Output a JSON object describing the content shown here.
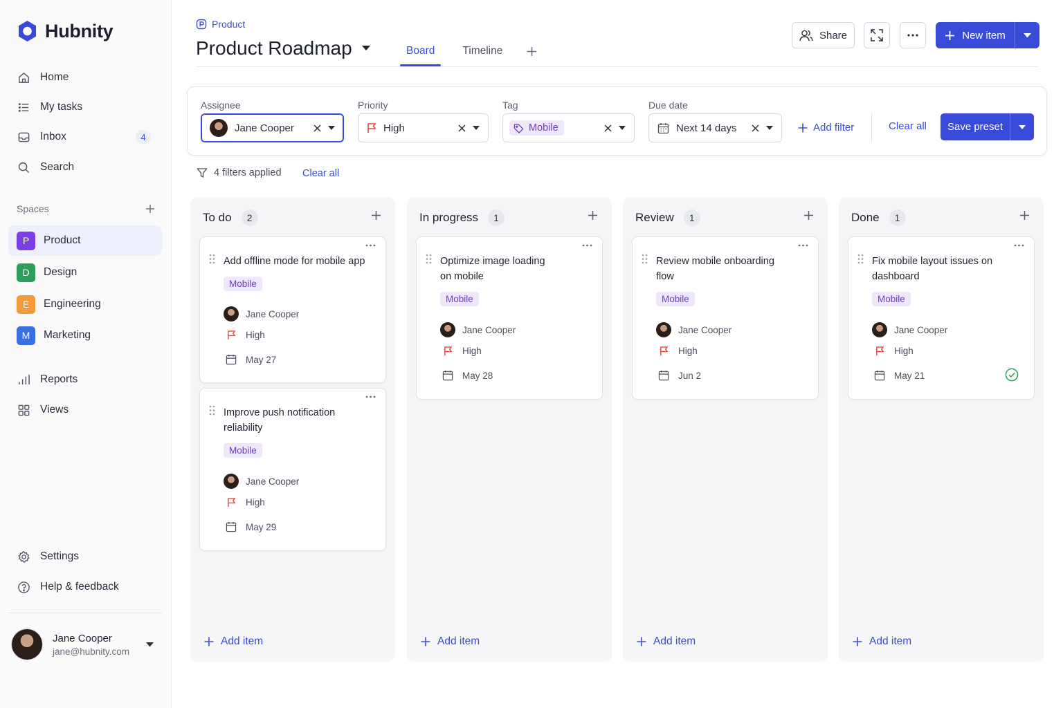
{
  "app": {
    "name": "Hubnity"
  },
  "sidebar": {
    "nav": [
      {
        "label": "Home"
      },
      {
        "label": "My tasks"
      },
      {
        "label": "Inbox",
        "badge": "4"
      },
      {
        "label": "Search"
      }
    ],
    "spaces_label": "Spaces",
    "spaces": [
      {
        "letter": "P",
        "label": "Product",
        "color": "#7b3fe4",
        "active": true
      },
      {
        "letter": "D",
        "label": "Design",
        "color": "#2f9e5a"
      },
      {
        "letter": "E",
        "label": "Engineering",
        "color": "#f39b3c"
      },
      {
        "letter": "M",
        "label": "Marketing",
        "color": "#3a6fe0"
      }
    ],
    "nav2": [
      {
        "label": "Reports"
      },
      {
        "label": "Views"
      }
    ],
    "bottom": [
      {
        "label": "Settings"
      },
      {
        "label": "Help & feedback"
      }
    ],
    "user": {
      "name": "Jane Cooper",
      "email": "jane@hubnity.com"
    }
  },
  "header": {
    "breadcrumb": "Product",
    "title": "Product Roadmap",
    "tabs": [
      {
        "label": "Board",
        "active": true
      },
      {
        "label": "Timeline"
      }
    ],
    "share_label": "Share",
    "new_item_label": "New item"
  },
  "filters": {
    "assignee": {
      "label": "Assignee",
      "value": "Jane Cooper"
    },
    "priority": {
      "label": "Priority",
      "value": "High"
    },
    "tag": {
      "label": "Tag",
      "value": "Mobile"
    },
    "due": {
      "label": "Due date",
      "value": "Next 14 days"
    },
    "add_filter": "Add filter",
    "clear_all": "Clear all",
    "save_preset": "Save preset",
    "summary": "4 filters applied",
    "summary_clear": "Clear all"
  },
  "board": {
    "add_item_label": "Add item",
    "columns": [
      {
        "title": "To do",
        "count": "2",
        "cards": [
          {
            "title": "Add offline mode for mobile app",
            "tag": "Mobile",
            "assignee": "Jane Cooper",
            "priority": "High",
            "due": "May 27"
          },
          {
            "title": "Improve push notification reliability",
            "tag": "Mobile",
            "assignee": "Jane Cooper",
            "priority": "High",
            "due": "May 29"
          }
        ]
      },
      {
        "title": "In progress",
        "count": "1",
        "cards": [
          {
            "title": "Optimize image loading on mobile",
            "tag": "Mobile",
            "assignee": "Jane Cooper",
            "priority": "High",
            "due": "May 28"
          }
        ]
      },
      {
        "title": "Review",
        "count": "1",
        "cards": [
          {
            "title": "Review mobile onboarding flow",
            "tag": "Mobile",
            "assignee": "Jane Cooper",
            "priority": "High",
            "due": "Jun 2"
          }
        ]
      },
      {
        "title": "Done",
        "count": "1",
        "cards": [
          {
            "title": "Fix mobile layout issues on dashboard",
            "tag": "Mobile",
            "assignee": "Jane Cooper",
            "priority": "High",
            "due": "May 21",
            "completed": true
          }
        ]
      }
    ]
  },
  "colors": {
    "accent": "#3a4ad8",
    "tag_bg": "#efe7fb",
    "tag_text": "#6b3ec0",
    "priority_flag": "#e5483d",
    "done_check": "#2ea35a"
  }
}
